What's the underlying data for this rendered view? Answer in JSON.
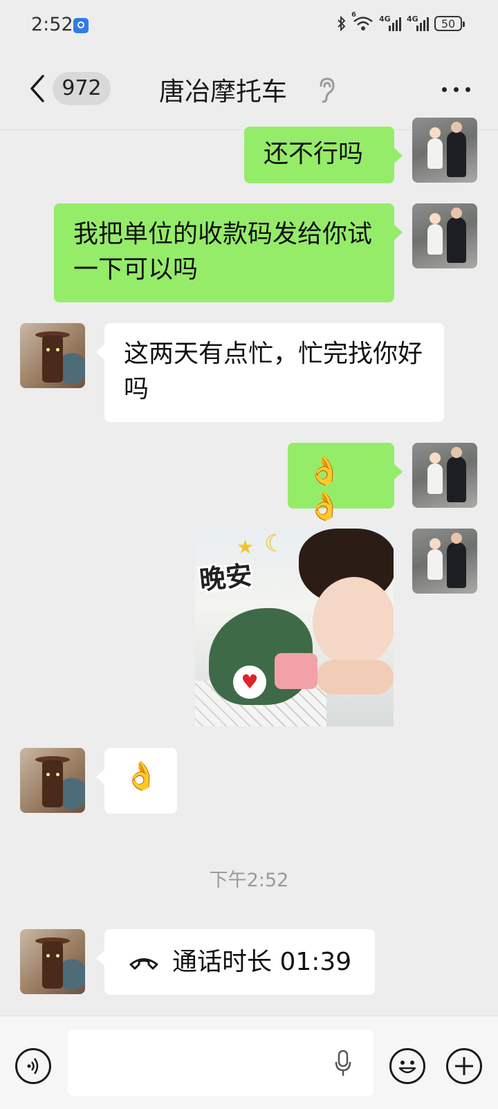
{
  "status_bar": {
    "time": "2:52",
    "network_1": "4G",
    "network_2": "4G",
    "wifi_badge": "6",
    "battery": "50"
  },
  "header": {
    "unread_count": "972",
    "title": "唐冶摩托车"
  },
  "messages": [
    {
      "side": "me",
      "type": "text",
      "text": "还不行吗"
    },
    {
      "side": "me",
      "type": "text",
      "text": "我把单位的收款码发给你试一下可以吗"
    },
    {
      "side": "other",
      "type": "text",
      "text": "这两天有点忙，忙完找你好吗"
    },
    {
      "side": "me",
      "type": "emoji",
      "text": "👌👌"
    },
    {
      "side": "me",
      "type": "sticker",
      "caption": "晚安"
    },
    {
      "side": "other",
      "type": "emoji",
      "text": "👌"
    },
    {
      "side": "system",
      "type": "timestamp",
      "text": "下午2:52"
    },
    {
      "side": "other",
      "type": "call",
      "text": "通话时长 01:39"
    }
  ],
  "colors": {
    "me_bubble": "#95ec69",
    "other_bubble": "#ffffff",
    "background": "#ededed"
  }
}
